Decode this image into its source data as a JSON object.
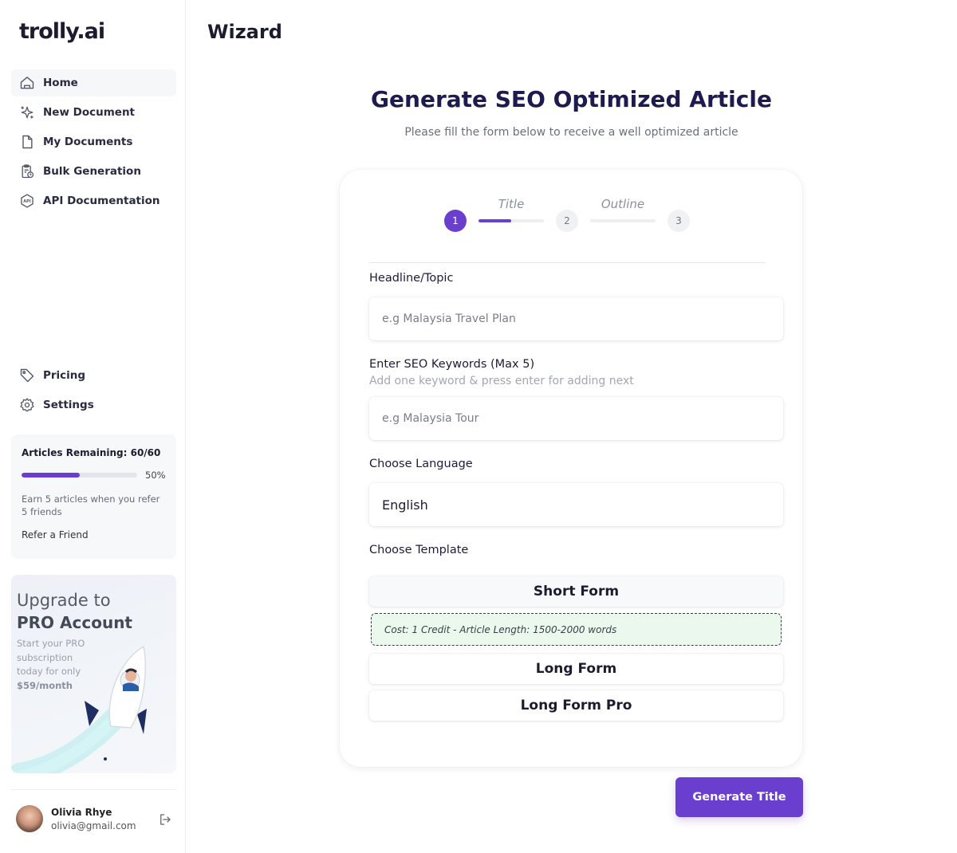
{
  "brand": {
    "logo_text": "trolly.ai",
    "accent": "#6a3fd0"
  },
  "sidebar": {
    "items": [
      {
        "label": "Home",
        "icon": "home-icon"
      },
      {
        "label": "New Document",
        "icon": "sparkle-icon"
      },
      {
        "label": "My Documents",
        "icon": "document-icon"
      },
      {
        "label": "Bulk Generation",
        "icon": "clipboard-clock-icon"
      },
      {
        "label": "API Documentation",
        "icon": "api-hexagon-icon"
      }
    ],
    "bottom_items": [
      {
        "label": "Pricing",
        "icon": "tag-icon"
      },
      {
        "label": "Settings",
        "icon": "gear-icon"
      }
    ],
    "credits": {
      "title": "Articles Remaining: 60/60",
      "progress_percent": 50,
      "progress_label": "50%",
      "description": "Earn 5 articles when you refer 5 friends",
      "refer_label": "Refer a Friend"
    },
    "promo": {
      "line1": "Upgrade to",
      "line2": "PRO Account",
      "sub": "Start your PRO subscription today for only",
      "price": "$59/month"
    },
    "user": {
      "name": "Olivia Rhye",
      "email": "olivia@gmail.com"
    }
  },
  "header": {
    "title": "Wizard"
  },
  "main": {
    "heading": "Generate SEO Optimized Article",
    "subheading": "Please fill the form below to receive a well optimized article",
    "steps": {
      "step1": "1",
      "step2": "2",
      "step3": "3",
      "seg1_label": "Title",
      "seg1_progress": 50,
      "seg2_label": "Outline",
      "seg2_progress": 0
    },
    "form": {
      "headline_label": "Headline/Topic",
      "headline_placeholder": "e.g Malaysia Travel Plan",
      "keywords_label": "Enter SEO Keywords (Max 5)",
      "keywords_hint": "Add one keyword & press enter for adding next",
      "keywords_placeholder": "e.g Malaysia Tour",
      "language_label": "Choose Language",
      "language_value": "English",
      "template_label": "Choose Template",
      "templates": [
        "Short Form",
        "Long Form",
        "Long Form Pro"
      ],
      "template_info": "Cost: 1 Credit  -  Article Length: 1500-2000 words"
    },
    "generate_button": "Generate Title"
  }
}
